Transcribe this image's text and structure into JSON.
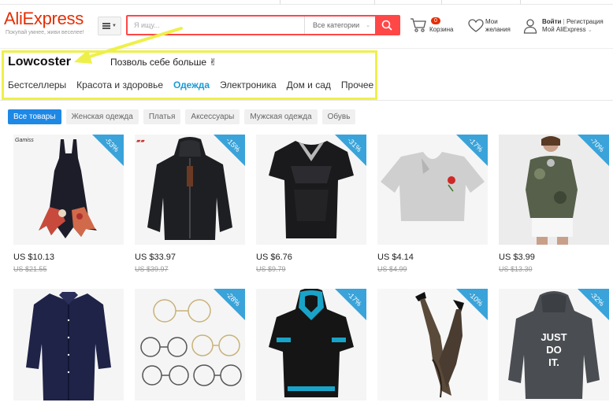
{
  "header": {
    "logo": "AliExpress",
    "tagline": "Покупай умнее, живи веселее!",
    "search_placeholder": "Я ищу...",
    "category_select": "Все категории",
    "cart_count": "0",
    "cart_label": "Корзина",
    "wishlist_line1": "Мои",
    "wishlist_line2": "желания",
    "login": "Войти",
    "register": "Регистрация",
    "account_line2": "Мой AliExpress"
  },
  "store": {
    "name": "Lowcoster",
    "slogan": "Позволь себе больше ✌",
    "nav": [
      "Бестселлеры",
      "Красота и здоровье",
      "Одежда",
      "Электроника",
      "Дом и сад",
      "Прочее"
    ],
    "active_nav": "Одежда"
  },
  "filters": [
    "Все товары",
    "Женская одежда",
    "Платья",
    "Аксессуары",
    "Мужская одежда",
    "Обувь"
  ],
  "products": [
    {
      "discount": "-53%",
      "price": "US $10.13",
      "old_price": "US $21.55",
      "brand": "Gamiss"
    },
    {
      "discount": "-15%",
      "price": "US $33.97",
      "old_price": "US $39.97",
      "brand": ""
    },
    {
      "discount": "-31%",
      "price": "US $6.76",
      "old_price": "US $9.79",
      "brand": ""
    },
    {
      "discount": "-17%",
      "price": "US $4.14",
      "old_price": "US $4.99",
      "brand": ""
    },
    {
      "discount": "-70%",
      "price": "US $3.99",
      "old_price": "US $13.30",
      "brand": ""
    },
    {
      "discount": "",
      "price": "",
      "old_price": "",
      "brand": ""
    },
    {
      "discount": "-28%",
      "price": "",
      "old_price": "",
      "brand": ""
    },
    {
      "discount": "-17%",
      "price": "",
      "old_price": "",
      "brand": ""
    },
    {
      "discount": "-10%",
      "price": "",
      "old_price": "",
      "brand": ""
    },
    {
      "discount": "-32%",
      "price": "",
      "old_price": "",
      "brand": ""
    }
  ],
  "hoodie_print": "JUST DO IT.",
  "colors": {
    "brand": "#e62e04",
    "search": "#ff4747",
    "active_link": "#1a9bd7",
    "discount_badge": "#3aa3d9",
    "highlight": "#eef04a"
  }
}
